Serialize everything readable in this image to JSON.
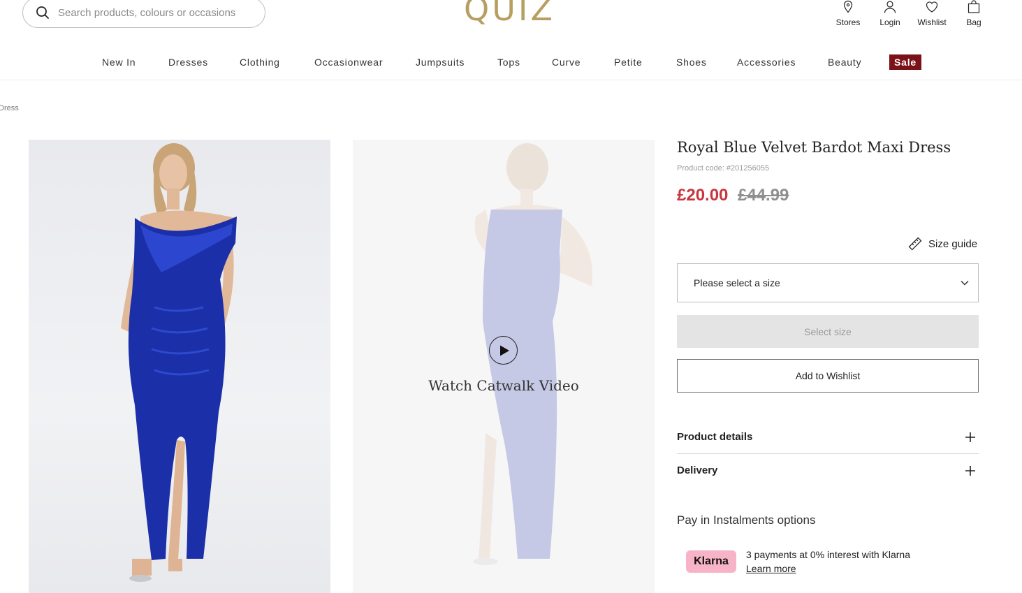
{
  "header": {
    "search_placeholder": "Search products, colours or occasions",
    "logo": "QUIZ",
    "icons": {
      "stores": {
        "label": "Stores",
        "icon": "location-pin-icon"
      },
      "login": {
        "label": "Login",
        "icon": "user-icon"
      },
      "wishlist": {
        "label": "Wishlist",
        "icon": "heart-icon"
      },
      "bag": {
        "label": "Bag",
        "icon": "bag-icon"
      }
    }
  },
  "nav": {
    "items": [
      "New In",
      "Dresses",
      "Clothing",
      "Occasionwear",
      "Jumpsuits",
      "Tops",
      "Curve",
      "Petite",
      "Shoes",
      "Accessories",
      "Beauty"
    ],
    "sale": "Sale",
    "sale_color": "#7a1218"
  },
  "breadcrumb": "Dress",
  "media": {
    "watch_label": "Watch Catwalk Video"
  },
  "product": {
    "title": "Royal Blue Velvet Bardot Maxi Dress",
    "code": "Product code: #201256055",
    "price_now": "£20.00",
    "price_was": "£44.99",
    "price_now_color": "#c8363f",
    "size_guide": "Size guide",
    "size_placeholder": "Please select a size",
    "select_size_btn": "Select size",
    "wishlist_btn": "Add to Wishlist",
    "accordions": [
      "Product details",
      "Delivery"
    ],
    "instalments_title": "Pay in Instalments options",
    "klarna": {
      "badge": "Klarna",
      "text": "3 payments at 0% interest with Klarna",
      "learn_more": "Learn more",
      "badge_color": "#f7b4c8"
    }
  }
}
